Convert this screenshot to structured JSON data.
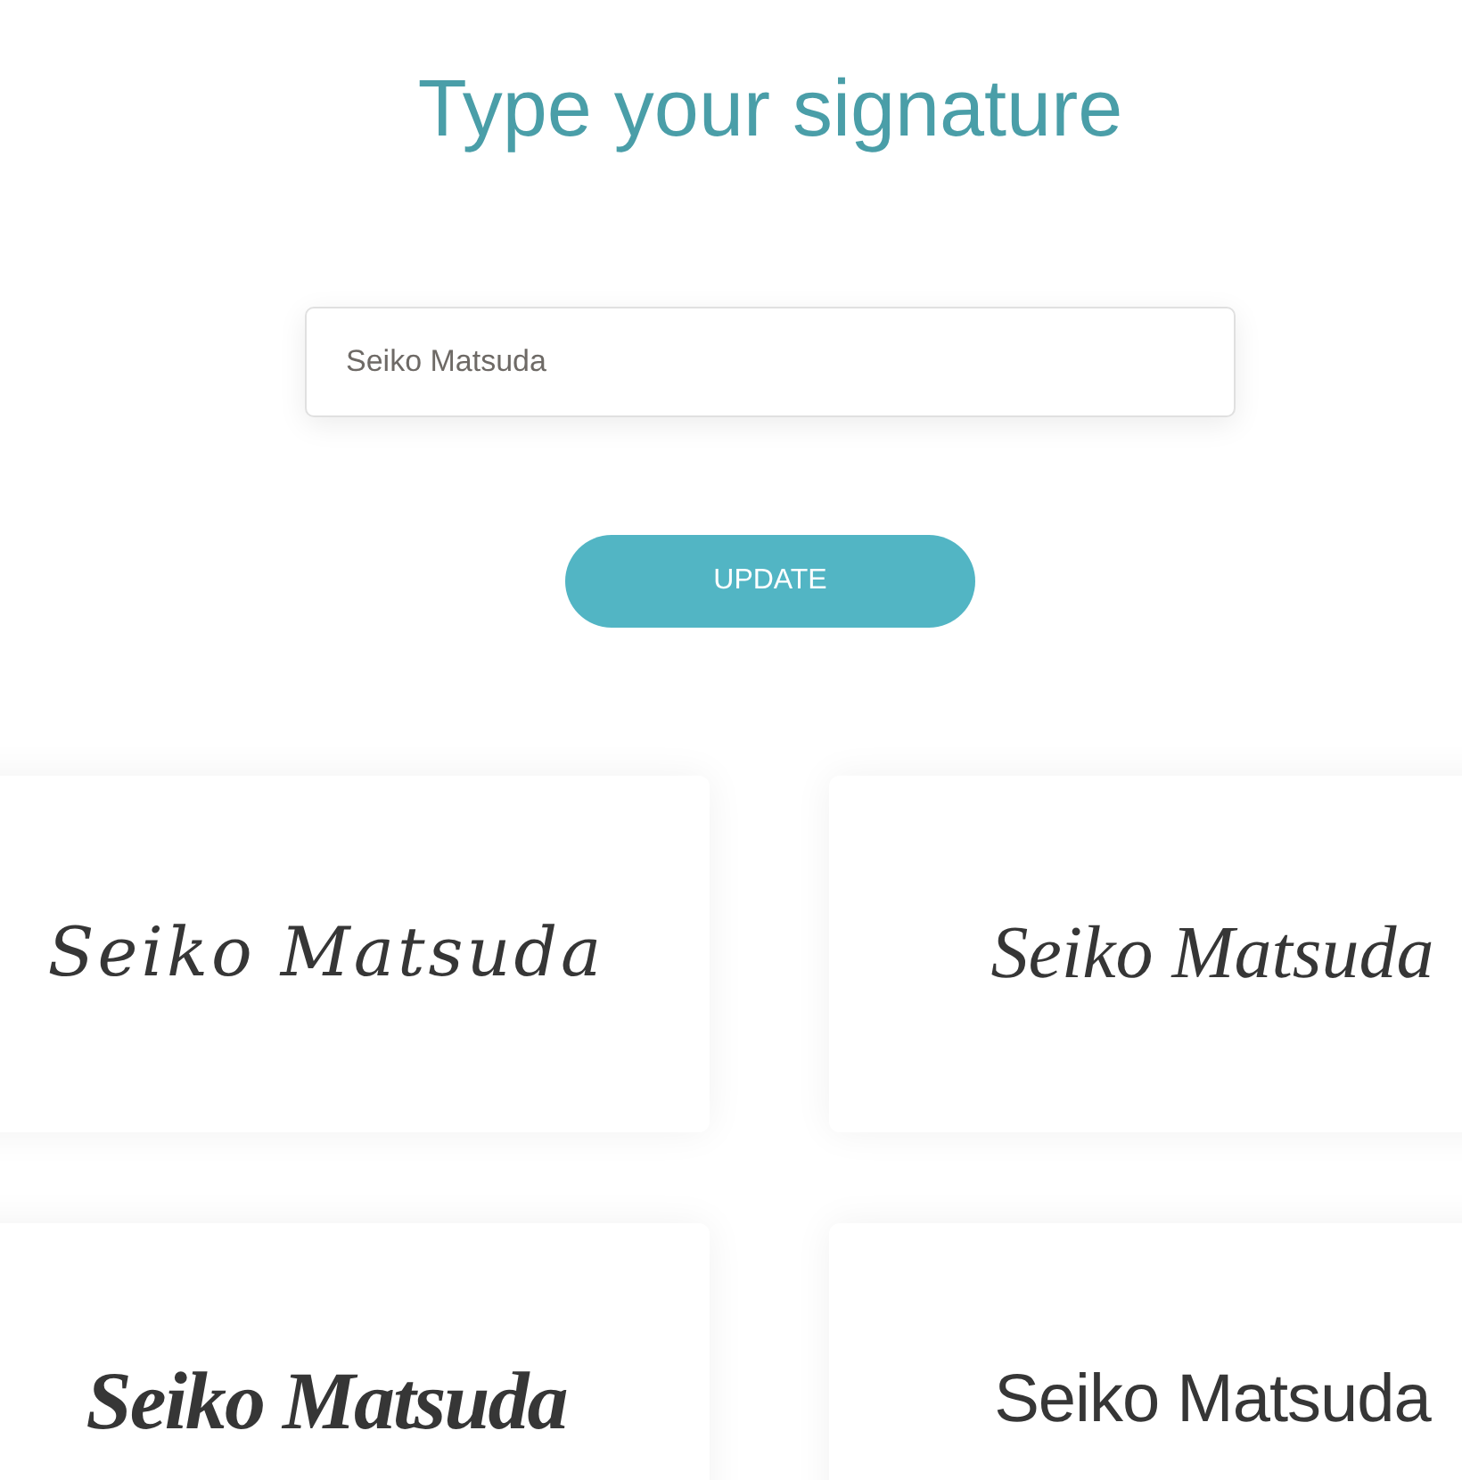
{
  "heading": "Type your signature",
  "name_field": {
    "value": "Seiko Matsuda"
  },
  "update_button": "UPDATE",
  "signatures": [
    {
      "kind": "script",
      "text": "Seiko Matsuda"
    },
    {
      "kind": "calligraphy",
      "text": "Seiko Matsuda"
    },
    {
      "kind": "brush",
      "text": "Seiko Matsuda"
    },
    {
      "kind": "marker",
      "text": "Seiko Matsuda"
    }
  ]
}
